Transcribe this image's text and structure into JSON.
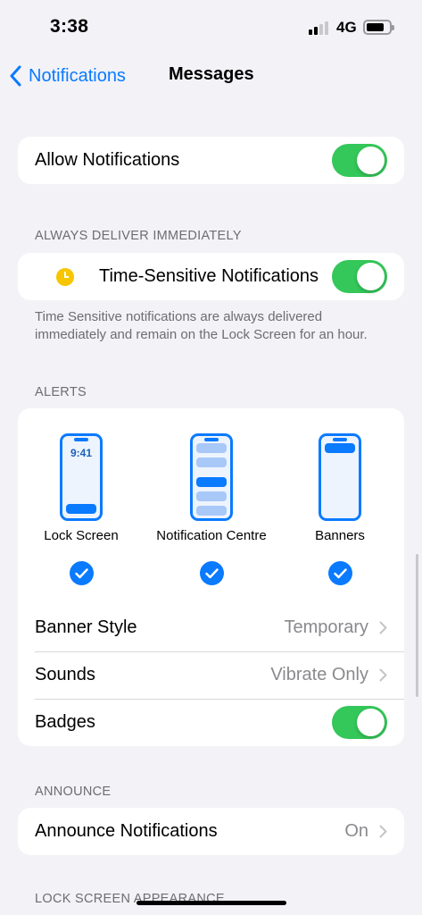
{
  "status": {
    "time": "3:38",
    "network": "4G"
  },
  "nav": {
    "back_label": "Notifications",
    "title": "Messages"
  },
  "allow_notifications": {
    "label": "Allow Notifications",
    "on": true
  },
  "always_deliver": {
    "header": "ALWAYS DELIVER IMMEDIATELY",
    "label": "Time-Sensitive Notifications",
    "on": true,
    "footnote": "Time Sensitive notifications are always delivered immediately and remain on the Lock Screen for an hour."
  },
  "alerts": {
    "header": "ALERTS",
    "options": [
      {
        "label": "Lock Screen",
        "phone_time": "9:41",
        "checked": true
      },
      {
        "label": "Notification Centre",
        "checked": true
      },
      {
        "label": "Banners",
        "checked": true
      }
    ],
    "banner_style": {
      "label": "Banner Style",
      "value": "Temporary"
    },
    "sounds": {
      "label": "Sounds",
      "value": "Vibrate Only"
    },
    "badges": {
      "label": "Badges",
      "on": true
    }
  },
  "announce": {
    "header": "ANNOUNCE",
    "label": "Announce Notifications",
    "value": "On"
  },
  "lock_screen_appearance": {
    "header": "LOCK SCREEN APPEARANCE"
  },
  "colors": {
    "accent": "#0a7aff",
    "toggle_on": "#34c759",
    "background": "#f2f2f7"
  }
}
